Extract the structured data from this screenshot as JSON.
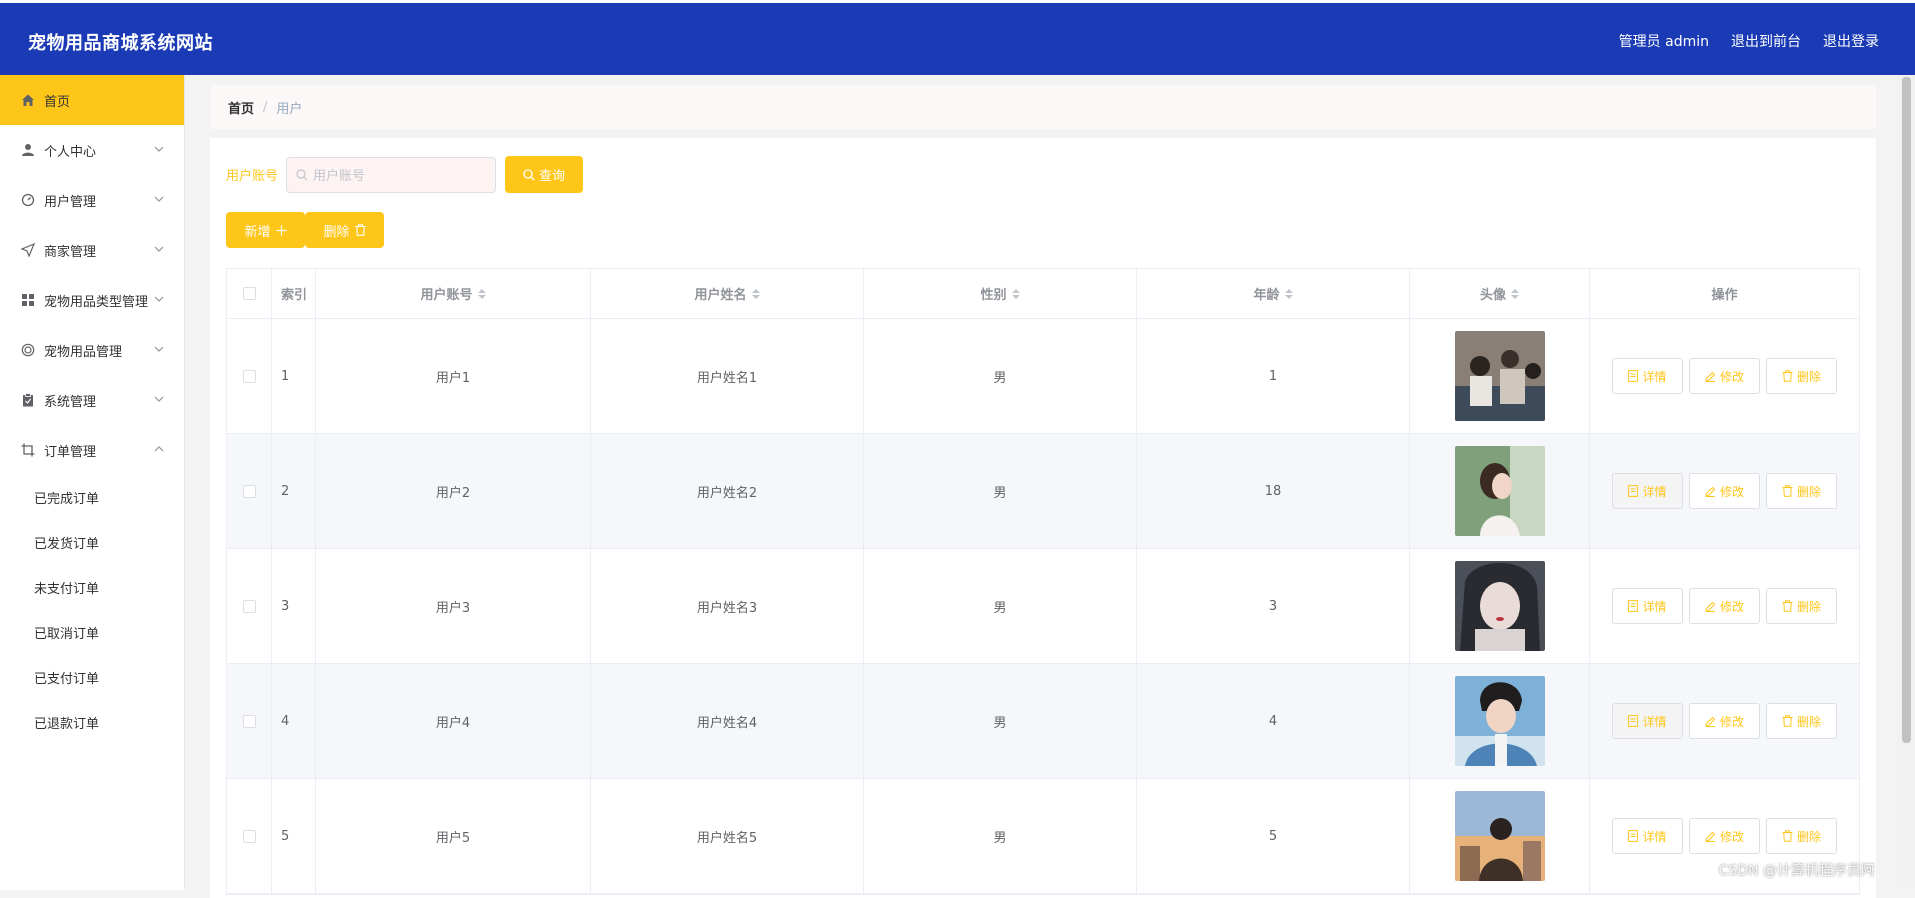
{
  "header": {
    "title": "宠物用品商城系统网站",
    "admin_label": "管理员 admin",
    "exit_front": "退出到前台",
    "logout": "退出登录"
  },
  "sidebar": {
    "items": [
      {
        "label": "首页",
        "icon": "home-icon"
      },
      {
        "label": "个人中心",
        "icon": "user-icon"
      },
      {
        "label": "用户管理",
        "icon": "dashboard-icon"
      },
      {
        "label": "商家管理",
        "icon": "navigation-icon"
      },
      {
        "label": "宠物用品类型管理",
        "icon": "grid-icon"
      },
      {
        "label": "宠物用品管理",
        "icon": "basketball-icon"
      },
      {
        "label": "系统管理",
        "icon": "clipboard-icon"
      },
      {
        "label": "订单管理",
        "icon": "crop-icon"
      }
    ],
    "order_sub": [
      "已完成订单",
      "已发货订单",
      "未支付订单",
      "已取消订单",
      "已支付订单",
      "已退款订单"
    ]
  },
  "breadcrumb": {
    "home": "首页",
    "current": "用户"
  },
  "search": {
    "label": "用户账号",
    "placeholder": "用户账号",
    "button": "查询"
  },
  "actions": {
    "add": "新增",
    "delete": "删除"
  },
  "table": {
    "headers": {
      "index": "索引",
      "account": "用户账号",
      "name": "用户姓名",
      "gender": "性别",
      "age": "年龄",
      "avatar": "头像",
      "ops": "操作"
    },
    "op_labels": {
      "detail": "详情",
      "edit": "修改",
      "delete": "删除"
    },
    "rows": [
      {
        "index": "1",
        "account": "用户1",
        "name": "用户姓名1",
        "gender": "男",
        "age": "1"
      },
      {
        "index": "2",
        "account": "用户2",
        "name": "用户姓名2",
        "gender": "男",
        "age": "18"
      },
      {
        "index": "3",
        "account": "用户3",
        "name": "用户姓名3",
        "gender": "男",
        "age": "3"
      },
      {
        "index": "4",
        "account": "用户4",
        "name": "用户姓名4",
        "gender": "男",
        "age": "4"
      },
      {
        "index": "5",
        "account": "用户5",
        "name": "用户姓名5",
        "gender": "男",
        "age": "5"
      }
    ]
  },
  "watermark": "CSDN @计算机程序员阿"
}
